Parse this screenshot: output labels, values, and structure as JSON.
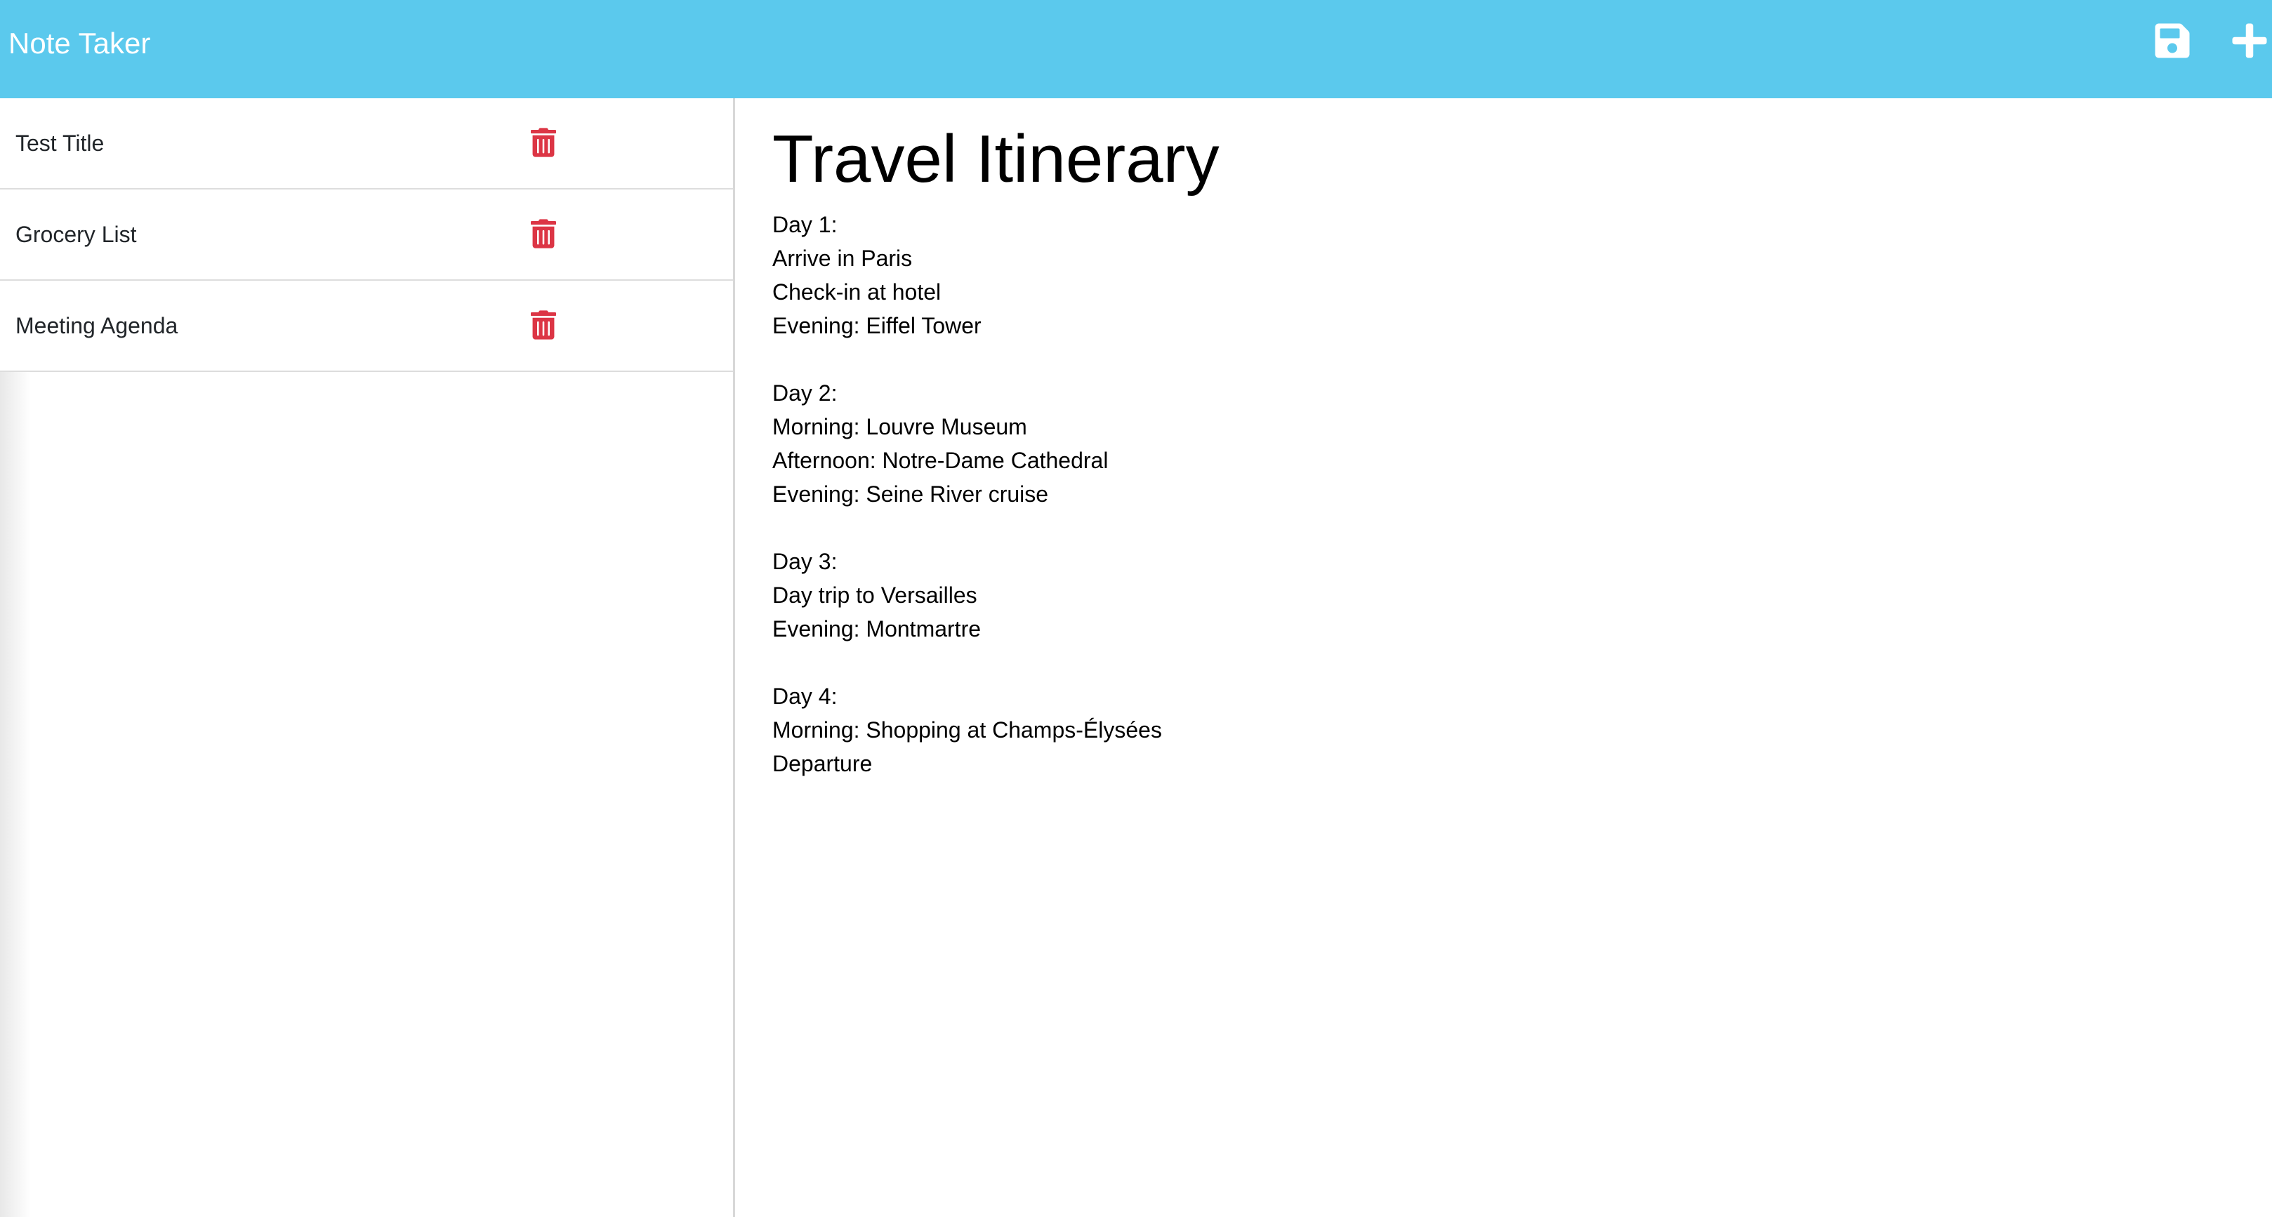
{
  "app": {
    "title": "Note Taker",
    "header_color": "#5bc9ed"
  },
  "toolbar": {
    "save_icon": "save-icon",
    "new_icon": "plus-icon"
  },
  "notes": [
    {
      "title": "Test Title",
      "delete_icon": "trash-icon"
    },
    {
      "title": "Grocery List",
      "delete_icon": "trash-icon"
    },
    {
      "title": "Meeting Agenda",
      "delete_icon": "trash-icon"
    }
  ],
  "active_note": {
    "title": "Travel Itinerary",
    "text": "Day 1:\nArrive in Paris\nCheck-in at hotel\nEvening: Eiffel Tower\n\nDay 2:\nMorning: Louvre Museum\nAfternoon: Notre-Dame Cathedral\nEvening: Seine River cruise\n\nDay 3:\nDay trip to Versailles\nEvening: Montmartre\n\nDay 4:\nMorning: Shopping at Champs-Élysées\nDeparture"
  },
  "colors": {
    "delete": "#dc3545",
    "text": "#212529"
  }
}
